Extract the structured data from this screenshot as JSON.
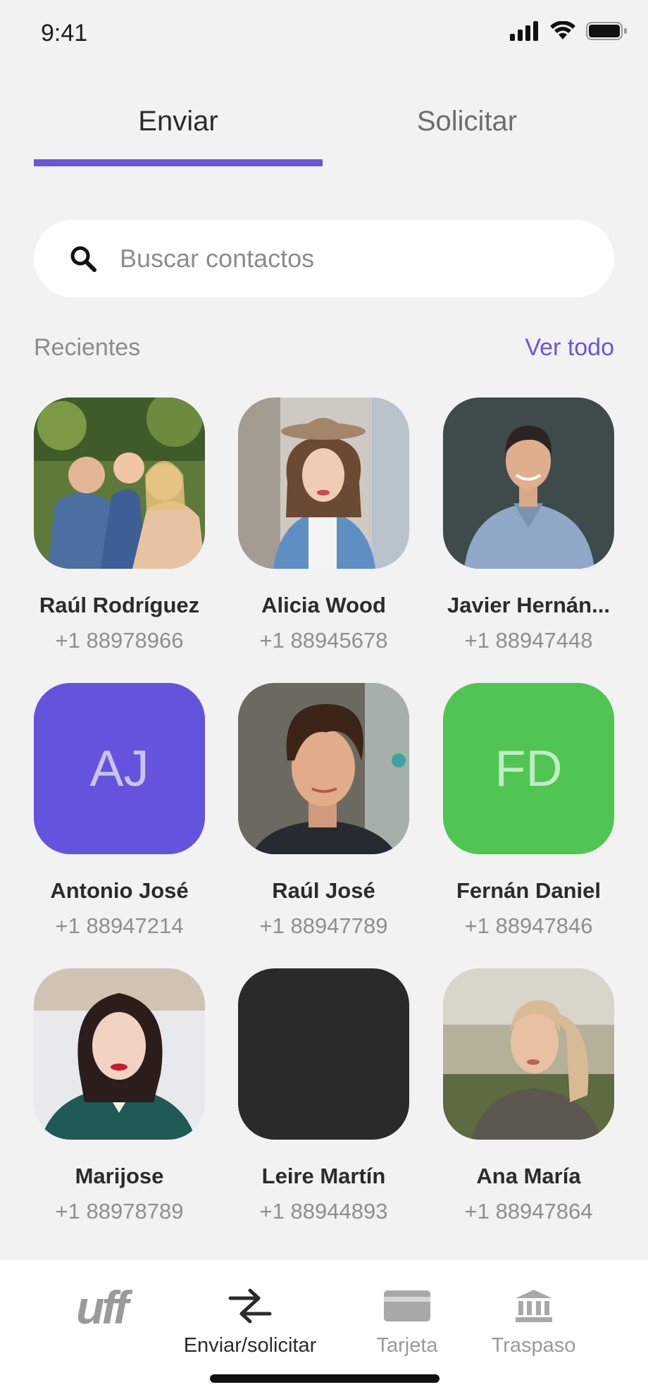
{
  "status": {
    "time": "9:41"
  },
  "tabs": {
    "send": "Enviar",
    "request": "Solicitar"
  },
  "search": {
    "placeholder": "Buscar contactos"
  },
  "recents": {
    "title": "Recientes",
    "see_all": "Ver todo",
    "contacts": [
      {
        "name": "Raúl Rodríguez",
        "phone": "+1 88978966",
        "avatar": "photo-family"
      },
      {
        "name": "Alicia Wood",
        "phone": "+1 88945678",
        "avatar": "photo-woman-hat"
      },
      {
        "name": "Javier Hernán...",
        "phone": "+1 88947448",
        "avatar": "photo-man-shirt"
      },
      {
        "name": "Antonio José",
        "phone": "+1 88947214",
        "initials": "AJ",
        "color": "#6453dc"
      },
      {
        "name": "Raúl José",
        "phone": "+1 88947789",
        "avatar": "photo-young-man"
      },
      {
        "name": "Fernán Daniel",
        "phone": "+1 88947846",
        "initials": "FD",
        "color": "#4fc552"
      },
      {
        "name": "Marijose",
        "phone": "+1 88978789",
        "avatar": "photo-woman-green"
      },
      {
        "name": "Leire Martín",
        "phone": "+1 88944893",
        "avatar": "dark-placeholder"
      },
      {
        "name": "Ana María",
        "phone": "+1 88947864",
        "avatar": "photo-woman-blonde"
      }
    ]
  },
  "nav": {
    "logo": "uff",
    "send_request": "Enviar/solicitar",
    "card": "Tarjeta",
    "transfer": "Traspaso"
  },
  "colors": {
    "accent": "#6a55dc"
  }
}
